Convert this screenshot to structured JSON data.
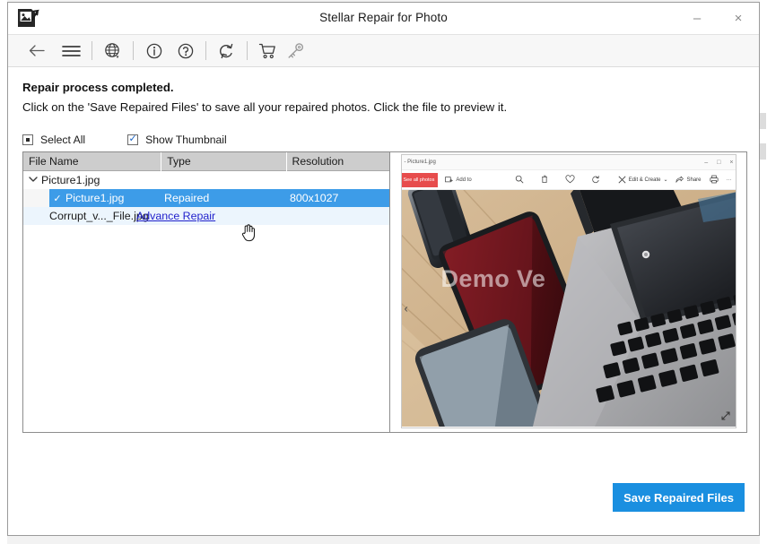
{
  "window": {
    "title": "Stellar Repair for Photo",
    "logo_icon": "photo-arrow-logo-icon",
    "minimize_label": "–",
    "close_label": "×"
  },
  "toolbar": {
    "items": [
      {
        "name": "back-icon",
        "glyph": "←"
      },
      {
        "name": "menu-icon",
        "glyph": "☰"
      },
      {
        "name": "globe-language-icon",
        "glyph": "globe"
      },
      {
        "name": "info-icon",
        "glyph": "info"
      },
      {
        "name": "help-icon",
        "glyph": "help"
      },
      {
        "name": "refresh-icon",
        "glyph": "refresh"
      },
      {
        "name": "cart-icon",
        "glyph": "cart"
      },
      {
        "name": "key-activate-icon",
        "glyph": "key"
      }
    ]
  },
  "messages": {
    "line1": "Repair process completed.",
    "line2": "Click on the 'Save Repaired Files' to save all your repaired photos. Click the file to preview it."
  },
  "options": {
    "select_all_label": "Select All",
    "select_all_state": "indeterminate",
    "show_thumbnail_label": "Show Thumbnail",
    "show_thumbnail_state": "checked"
  },
  "filelist": {
    "columns": [
      "File Name",
      "Type",
      "Resolution"
    ],
    "rows": [
      {
        "kind": "group",
        "chevron": "⌄",
        "file_name": "Picture1.jpg",
        "type": "",
        "resolution": ""
      },
      {
        "kind": "child-selected",
        "check": "✓",
        "file_name": "Picture1.jpg",
        "type": "Repaired",
        "resolution": "800x1027"
      },
      {
        "kind": "child-link",
        "file_name": "Corrupt_v..._File.jpg",
        "type": "Advance Repair",
        "resolution": ""
      }
    ]
  },
  "preview": {
    "window_title": "- Picture1.jpg",
    "minimize_label": "–",
    "maximize_label": "□",
    "close_label": "×",
    "see_all_photos_label": "See all photos",
    "add_to_label": "Add to",
    "zoom_icon": "zoom-icon",
    "delete_icon": "trash-icon",
    "favorite_icon": "heart-icon",
    "rotate_icon": "rotate-icon",
    "edit_create_label": "Edit & Create",
    "edit_create_chevron": "⌄",
    "share_label": "Share",
    "print_icon": "print-icon",
    "more_label": "···",
    "prev_arrow": "‹",
    "expand_icon": "expand-icon",
    "watermark": "Demo Ve"
  },
  "footer": {
    "save_button_label": "Save Repaired Files"
  },
  "colors": {
    "accent_blue": "#1a8fe0",
    "selected_row": "#3d9ce8",
    "alt_row": "#ecf5fd",
    "link": "#2222cc",
    "header_bg": "#cdcdcd"
  }
}
